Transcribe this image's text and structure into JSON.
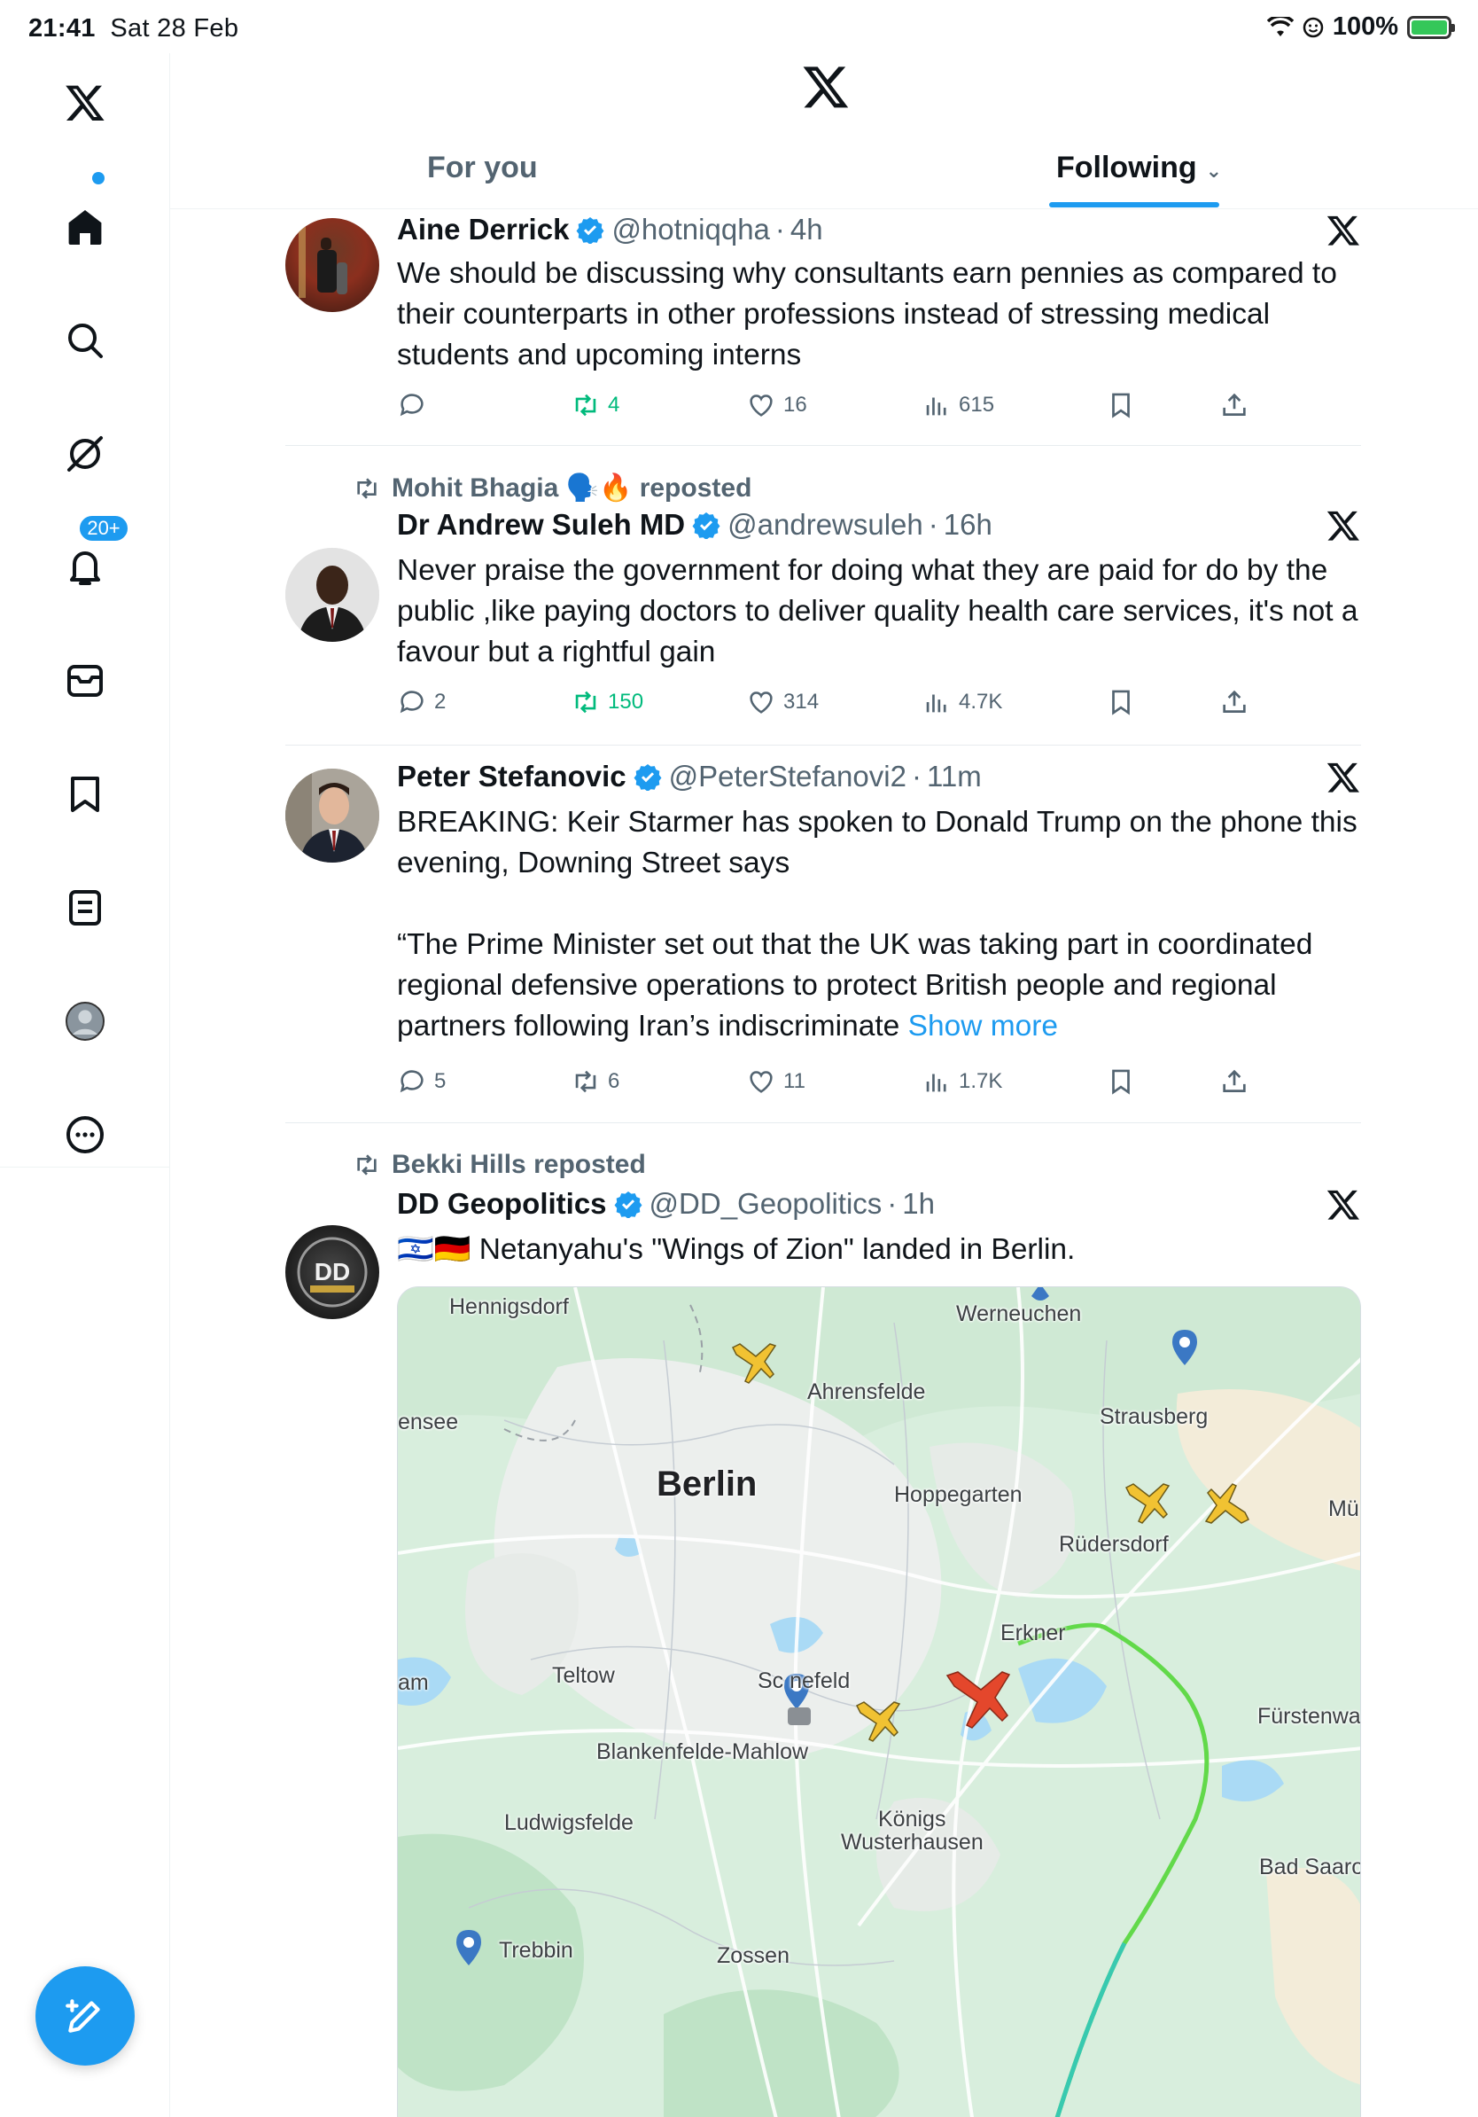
{
  "status_bar": {
    "time": "21:41",
    "date": "Sat 28 Feb",
    "battery": "100%",
    "icons": [
      "wifi-icon",
      "focus-icon",
      "battery-charging-icon"
    ]
  },
  "sidebar": {
    "items": [
      {
        "name": "home",
        "icon": "home-icon"
      },
      {
        "name": "explore",
        "icon": "search-icon"
      },
      {
        "name": "grok",
        "icon": "grok-icon"
      },
      {
        "name": "notifications",
        "icon": "bell-icon",
        "badge": "20+"
      },
      {
        "name": "messages",
        "icon": "mail-icon"
      },
      {
        "name": "bookmarks",
        "icon": "bookmark-icon"
      },
      {
        "name": "lists",
        "icon": "list-icon"
      },
      {
        "name": "profile",
        "icon": "profile-icon"
      },
      {
        "name": "more",
        "icon": "more-icon"
      }
    ]
  },
  "header": {
    "tabs": [
      {
        "label": "For you",
        "active": false
      },
      {
        "label": "Following",
        "active": true
      }
    ]
  },
  "posts": [
    {
      "name": "Aine Derrick",
      "handle": "@hotniqqha",
      "sep": "·",
      "time": "4h",
      "body": "We should be discussing why consultants earn pennies as compared to their counterparts in other professions instead of stressing medical students and upcoming interns",
      "replies": "",
      "reposts": "4",
      "likes": "16",
      "views": "615"
    },
    {
      "repost_by": "Mohit Bhagia 🗣️🔥 reposted",
      "name": "Dr Andrew Suleh MD",
      "handle": "@andrewsuleh",
      "sep": "·",
      "time": "16h",
      "body": "Never praise the government  for doing what they are paid for do by the public ,like paying doctors to deliver quality health care services, it's not a favour but a rightful gain",
      "replies": "2",
      "reposts": "150",
      "likes": "314",
      "views": "4.7K"
    },
    {
      "name": "Peter Stefanovic",
      "handle": "@PeterStefanovi2",
      "sep": "·",
      "time": "11m",
      "body_p1": "BREAKING: Keir Starmer has spoken to Donald Trump on the phone this evening, Downing Street says",
      "body_p2": "“The Prime Minister set out that the UK was taking part in coordinated regional defensive operations to protect British people and regional partners following Iran’s indiscriminate",
      "show_more": "Show more",
      "replies": "5",
      "reposts": "6",
      "likes": "11",
      "views": "1.7K"
    },
    {
      "repost_by": "Bekki Hills reposted",
      "name": "DD Geopolitics",
      "handle": "@DD_Geopolitics",
      "sep": "·",
      "time": "1h",
      "body": "🇮🇱🇩🇪 Netanyahu's \"Wings of Zion\" landed in Berlin.",
      "avatar_text": "DD"
    }
  ],
  "map_labels": {
    "berlin": "Berlin",
    "hennigsdorf": "Hennigsdorf",
    "werneuchen": "Werneuchen",
    "ahrensfelde": "Ahrensfelde",
    "strausberg": "Strausberg",
    "hoppegarten": "Hoppegarten",
    "rudersdorf": "Rüdersdorf",
    "mu": "Mü",
    "ensee": "ensee",
    "erkner": "Erkner",
    "teltow": "Teltow",
    "am": "am",
    "schonefeld": "Sc  nefeld",
    "furstenwalde": "Fürstenwa",
    "blankenfelde": "Blankenfelde-Mahlow",
    "ludwigsfelde": "Ludwigsfelde",
    "konigs": "Königs",
    "wusterhausen": "Wusterhausen",
    "badsaarow": "Bad Saaro",
    "trebbin": "Trebbin",
    "zossen": "Zossen"
  },
  "colors": {
    "accent": "#1d9bf0",
    "repost": "#00ba7c",
    "muted": "#536471",
    "text": "#0f1419",
    "flight_path": "#62d94a"
  }
}
